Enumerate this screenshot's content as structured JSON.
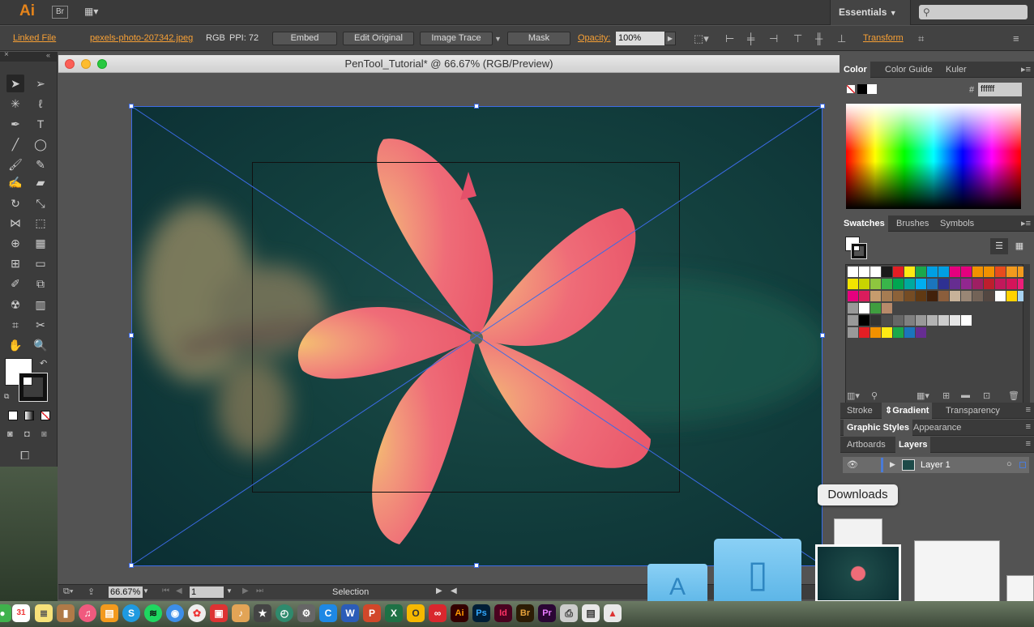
{
  "appbar": {
    "logo": "Ai",
    "bridge": "Br",
    "workspace": "Essentials"
  },
  "control_bar": {
    "linked_file": "Linked File",
    "filename": "pexels-photo-207342.jpeg",
    "color_mode": "RGB",
    "ppi": "PPI: 72",
    "embed": "Embed",
    "edit_original": "Edit Original",
    "image_trace": "Image Trace",
    "mask": "Mask",
    "opacity_label": "Opacity:",
    "opacity_value": "100%",
    "transform": "Transform"
  },
  "document": {
    "title": "PenTool_Tutorial* @ 66.67% (RGB/Preview)"
  },
  "status_bar": {
    "zoom": "66.67%",
    "artboard": "1",
    "tool": "Selection"
  },
  "color_panel": {
    "tabs": [
      "Color",
      "Color Guide",
      "Kuler"
    ],
    "hex_label": "#",
    "hex_value": "ffffff"
  },
  "swatches_panel": {
    "tabs": [
      "Swatches",
      "Brushes",
      "Symbols"
    ]
  },
  "stroke_panel": {
    "tabs": [
      "Stroke",
      "Gradient",
      "Transparency"
    ]
  },
  "styles_panel": {
    "tabs": [
      "Graphic Styles",
      "Appearance"
    ]
  },
  "layers_panel": {
    "tabs": [
      "Artboards",
      "Layers"
    ],
    "layer_name": "Layer 1"
  },
  "dock": {
    "downloads_tooltip": "Downloads",
    "calendar_day": "31"
  },
  "colors": {
    "accent": "#f7a035",
    "selection": "#3c6be6",
    "title_bar": "#dcdcdc"
  },
  "swatch_rows": [
    [
      "#ffffff",
      "#ffffff",
      "#ffffff",
      "#1a1a1a",
      "#e31e24",
      "#fdea14",
      "#1ba84b",
      "#009fe3",
      "#009fe3",
      "#e5007e",
      "#e5007e",
      "#f29100",
      "#f29100",
      "#e84c1e",
      "#f39a1d",
      "#f39a1d"
    ],
    [
      "#f2e500",
      "#c8d400",
      "#8ec63f",
      "#39b54a",
      "#00a651",
      "#00a99d",
      "#00aeef",
      "#1b75bc",
      "#2e3192",
      "#662d91",
      "#92278f",
      "#9e1f63",
      "#be1e2d",
      "#c2185b",
      "#d4145a",
      "#ed1e79"
    ],
    [
      "#e6007e",
      "#da1c5c",
      "#c69c6d",
      "#a67c52",
      "#8c6239",
      "#754c24",
      "#603913",
      "#42210b",
      "#8b5e3c",
      "#c7b299",
      "#998675",
      "#736357",
      "#534741",
      "#fefefe",
      "#ffd200",
      "#a7d3f2"
    ],
    [
      "#ffffff",
      "#3f9d3f",
      "#b88a6a"
    ],
    [
      "#000000",
      "#333333",
      "#4d4d4d",
      "#666666",
      "#808080",
      "#999999",
      "#b3b3b3",
      "#cccccc",
      "#e6e6e6",
      "#ffffff"
    ],
    [
      "#e31e24",
      "#f29100",
      "#fdea14",
      "#1ba84b",
      "#1b75bc",
      "#662d91"
    ]
  ]
}
